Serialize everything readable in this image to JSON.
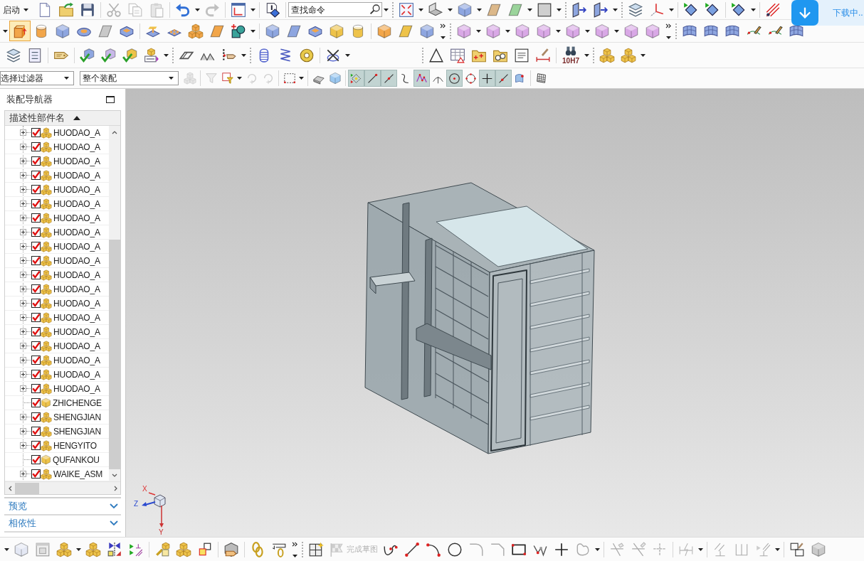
{
  "menu": {
    "start": "启动"
  },
  "quick_access": {
    "clipboard": [
      {
        "disabled": true
      },
      {
        "disabled": true
      },
      {
        "disabled": true
      }
    ],
    "undo": {
      "disabled": false
    },
    "redo": {
      "disabled": true
    }
  },
  "command_search": {
    "placeholder": "查找命令"
  },
  "download": {
    "label": "下载中.."
  },
  "feature_tools": [
    {
      "selected": true
    },
    {
      "selected": false
    },
    {
      "selected": false
    },
    {
      "selected": false
    },
    {
      "selected": false
    },
    {
      "selected": false
    }
  ],
  "tolerance_tool": {
    "label": "10H7"
  },
  "selection_bar": {
    "filter": "选择过滤器",
    "scope": "整个装配",
    "filter_tools": [
      {
        "disabled": true
      },
      {
        "disabled": true
      },
      {
        "disabled": false
      },
      {
        "disabled": true
      },
      {
        "disabled": true
      }
    ],
    "snap_points": [
      {
        "selected": true
      },
      {
        "selected": true
      },
      {
        "selected": true
      },
      {
        "selected": false
      },
      {
        "selected": true
      },
      {
        "selected": false
      },
      {
        "selected": true
      },
      {
        "selected": false
      },
      {
        "selected": true
      },
      {
        "selected": true
      },
      {
        "selected": false
      }
    ]
  },
  "navigator": {
    "title": "装配导航器",
    "column": "描述性部件名",
    "sort_ascending": true,
    "items": [
      {
        "name": "HUODAO_A",
        "kind": "assembly",
        "expanded": false,
        "checked": true
      },
      {
        "name": "HUODAO_A",
        "kind": "assembly",
        "expanded": false,
        "checked": true
      },
      {
        "name": "HUODAO_A",
        "kind": "assembly",
        "expanded": false,
        "checked": true
      },
      {
        "name": "HUODAO_A",
        "kind": "assembly",
        "expanded": false,
        "checked": true
      },
      {
        "name": "HUODAO_A",
        "kind": "assembly",
        "expanded": false,
        "checked": true
      },
      {
        "name": "HUODAO_A",
        "kind": "assembly",
        "expanded": false,
        "checked": true
      },
      {
        "name": "HUODAO_A",
        "kind": "assembly",
        "expanded": false,
        "checked": true
      },
      {
        "name": "HUODAO_A",
        "kind": "assembly",
        "expanded": false,
        "checked": true
      },
      {
        "name": "HUODAO_A",
        "kind": "assembly",
        "expanded": false,
        "checked": true
      },
      {
        "name": "HUODAO_A",
        "kind": "assembly",
        "expanded": false,
        "checked": true
      },
      {
        "name": "HUODAO_A",
        "kind": "assembly",
        "expanded": false,
        "checked": true
      },
      {
        "name": "HUODAO_A",
        "kind": "assembly",
        "expanded": false,
        "checked": true
      },
      {
        "name": "HUODAO_A",
        "kind": "assembly",
        "expanded": false,
        "checked": true
      },
      {
        "name": "HUODAO_A",
        "kind": "assembly",
        "expanded": false,
        "checked": true
      },
      {
        "name": "HUODAO_A",
        "kind": "assembly",
        "expanded": false,
        "checked": true
      },
      {
        "name": "HUODAO_A",
        "kind": "assembly",
        "expanded": false,
        "checked": true
      },
      {
        "name": "HUODAO_A",
        "kind": "assembly",
        "expanded": false,
        "checked": true
      },
      {
        "name": "HUODAO_A",
        "kind": "assembly",
        "expanded": false,
        "checked": true
      },
      {
        "name": "HUODAO_A",
        "kind": "assembly",
        "expanded": false,
        "checked": true
      },
      {
        "name": "ZHICHENGE",
        "kind": "part",
        "checked": true
      },
      {
        "name": "SHENGJIAN",
        "kind": "assembly",
        "expanded": false,
        "checked": true
      },
      {
        "name": "SHENGJIAN",
        "kind": "assembly",
        "expanded": false,
        "checked": true
      },
      {
        "name": "HENGYITO",
        "kind": "assembly",
        "expanded": false,
        "checked": true
      },
      {
        "name": "QUFANKOU",
        "kind": "part",
        "checked": true
      },
      {
        "name": "WAIKE_ASM",
        "kind": "assembly",
        "expanded": false,
        "checked": true
      }
    ]
  },
  "panels": [
    {
      "title": "预览",
      "expanded": false
    },
    {
      "title": "相依性",
      "expanded": false
    }
  ],
  "viewport": {
    "axes": {
      "x": "X",
      "y": "Y",
      "z": "Z"
    }
  },
  "sketch_bar": {
    "finish": {
      "label": "完成草图",
      "disabled": true
    },
    "curve_tools": [
      {
        "disabled": false
      },
      {
        "disabled": false
      },
      {
        "disabled": false
      },
      {
        "disabled": false
      },
      {
        "disabled": true
      },
      {
        "disabled": true
      },
      {
        "disabled": false
      },
      {
        "disabled": false
      },
      {
        "disabled": false
      },
      {
        "disabled": true
      }
    ],
    "edit_tools": [
      {
        "disabled": true
      },
      {
        "disabled": true
      },
      {
        "disabled": true
      },
      {
        "disabled": true
      },
      {
        "disabled": true
      },
      {
        "disabled": true
      },
      {
        "disabled": true
      }
    ]
  }
}
